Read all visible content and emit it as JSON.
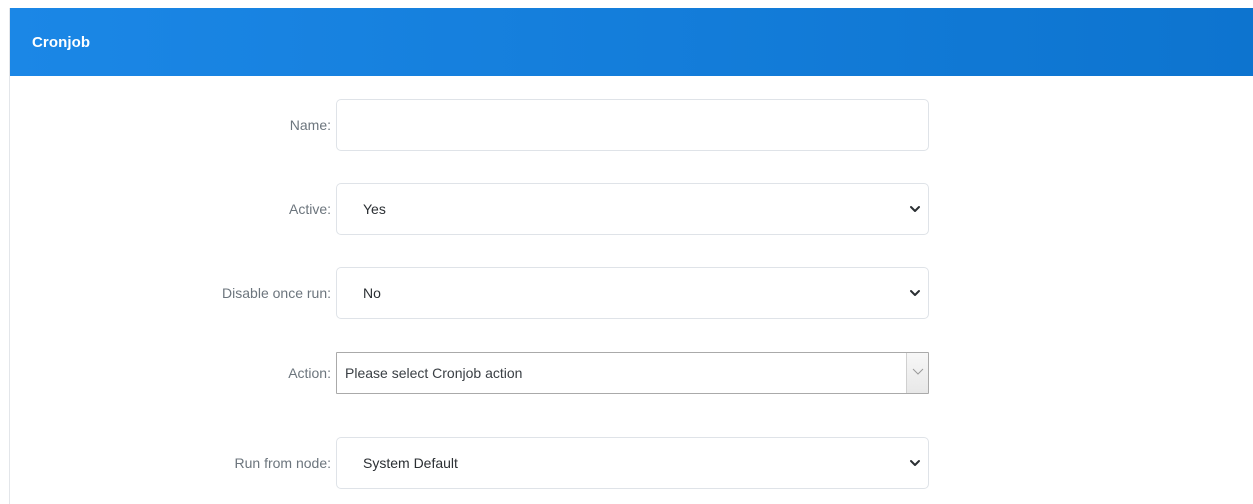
{
  "panel": {
    "title": "Cronjob"
  },
  "form": {
    "name": {
      "label": "Name:",
      "value": ""
    },
    "active": {
      "label": "Active:",
      "selected": "Yes"
    },
    "disable_once_run": {
      "label": "Disable once run:",
      "selected": "No"
    },
    "action": {
      "label": "Action:",
      "placeholder": "Please select Cronjob action"
    },
    "run_from_node": {
      "label": "Run from node:",
      "selected": "System Default"
    }
  },
  "colors": {
    "header_start": "#1b87e6",
    "header_end": "#0d74cf",
    "label_text": "#6c757d",
    "input_border": "#dfe3e8"
  },
  "icons": {
    "select_arrow": "chevron-down-icon"
  }
}
